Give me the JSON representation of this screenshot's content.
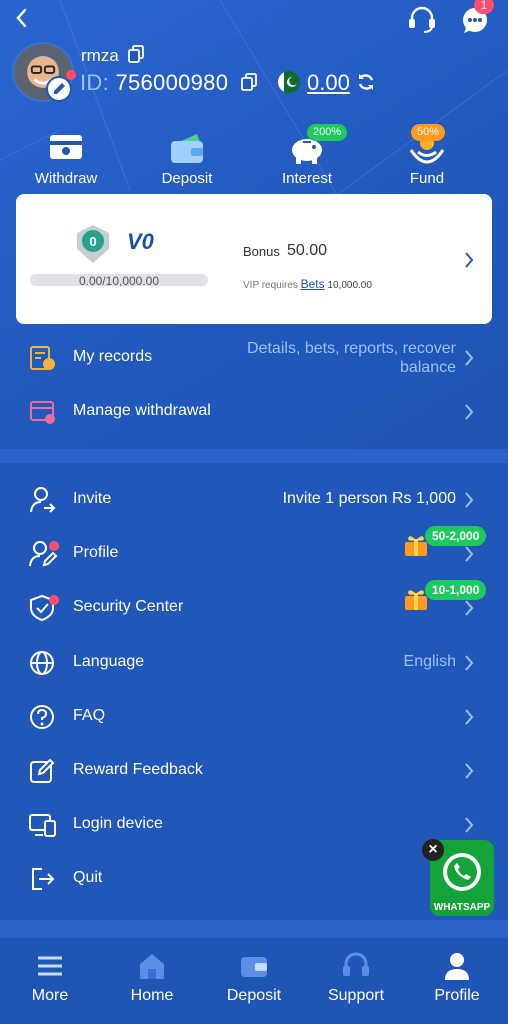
{
  "header": {
    "badge_count": "1"
  },
  "user": {
    "name": "rmza",
    "id_label": "ID:",
    "id_value": "756000980",
    "balance": "0.00"
  },
  "quick_actions": [
    {
      "label": "Withdraw",
      "icon": "withdraw-icon"
    },
    {
      "label": "Deposit",
      "icon": "wallet-icon"
    },
    {
      "label": "Interest",
      "icon": "piggy-bank-icon",
      "tag": "200%"
    },
    {
      "label": "Fund",
      "icon": "fund-icon",
      "tag": "50%"
    }
  ],
  "vip": {
    "level_badge": "0",
    "level": "V0",
    "progress_text": "0.00/10,000.00",
    "progress": 0,
    "bonus_label": "Bonus",
    "bonus_value": "50.00",
    "requires_label": "VIP requires",
    "bets_link": "Bets",
    "requires_amount": "10,000.00"
  },
  "menu_top": [
    {
      "label": "My records",
      "value_line1": "Details, bets, reports, recover",
      "value_line2": "balance",
      "icon": "records-icon"
    },
    {
      "label": "Manage withdrawal",
      "icon": "manage-withdrawal-icon"
    }
  ],
  "menu": [
    {
      "label": "Invite",
      "value": "Invite 1 person Rs 1,000",
      "icon": "invite-icon"
    },
    {
      "label": "Profile",
      "gift_tag": "50-2,000",
      "icon": "profile-edit-icon"
    },
    {
      "label": "Security Center",
      "gift_tag": "10-1,000",
      "icon": "shield-icon"
    },
    {
      "label": "Language",
      "value": "English",
      "icon": "globe-icon"
    },
    {
      "label": "FAQ",
      "icon": "question-icon"
    },
    {
      "label": "Reward Feedback",
      "icon": "edit-icon"
    },
    {
      "label": "Login device",
      "icon": "device-icon"
    },
    {
      "label": "Quit",
      "icon": "logout-icon"
    }
  ],
  "whatsapp": {
    "label": "WHATSAPP",
    "close": "×"
  },
  "tabs": [
    {
      "label": "More",
      "icon": "menu-icon"
    },
    {
      "label": "Home",
      "icon": "home-icon"
    },
    {
      "label": "Deposit",
      "icon": "wallet-icon"
    },
    {
      "label": "Support",
      "icon": "headset-icon"
    },
    {
      "label": "Profile",
      "icon": "user-icon"
    }
  ],
  "colors": {
    "background": "#2057b8",
    "accent_text": "#9cc0ff",
    "badge": "#ff4d6d",
    "green_tag": "#1ec95f",
    "orange_tag": "#ff9a1f"
  }
}
